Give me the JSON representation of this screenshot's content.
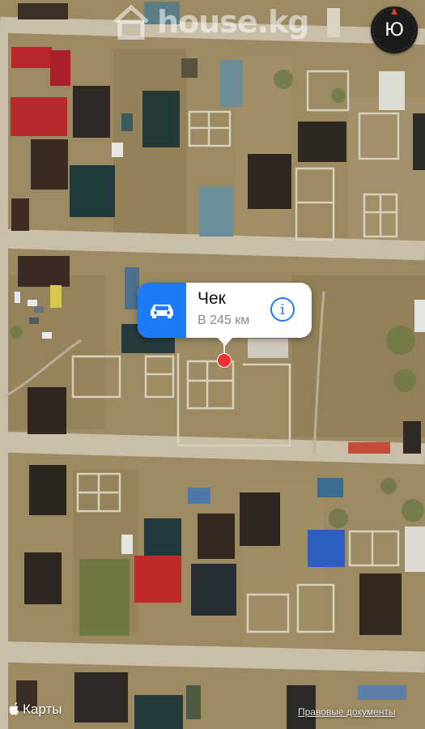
{
  "watermark": {
    "text": "house.kg"
  },
  "compass": {
    "label": "Ю",
    "icon": "compass-icon"
  },
  "callout": {
    "title": "Чек",
    "subtitle": "В 245 км",
    "icon": "car-icon",
    "info_icon": "info-icon",
    "info_label": "i",
    "accent_color": "#1b7cf5"
  },
  "pin": {
    "color": "#f23030"
  },
  "footer": {
    "brand_label": "Карты",
    "legal_link": "Правовые документы"
  }
}
